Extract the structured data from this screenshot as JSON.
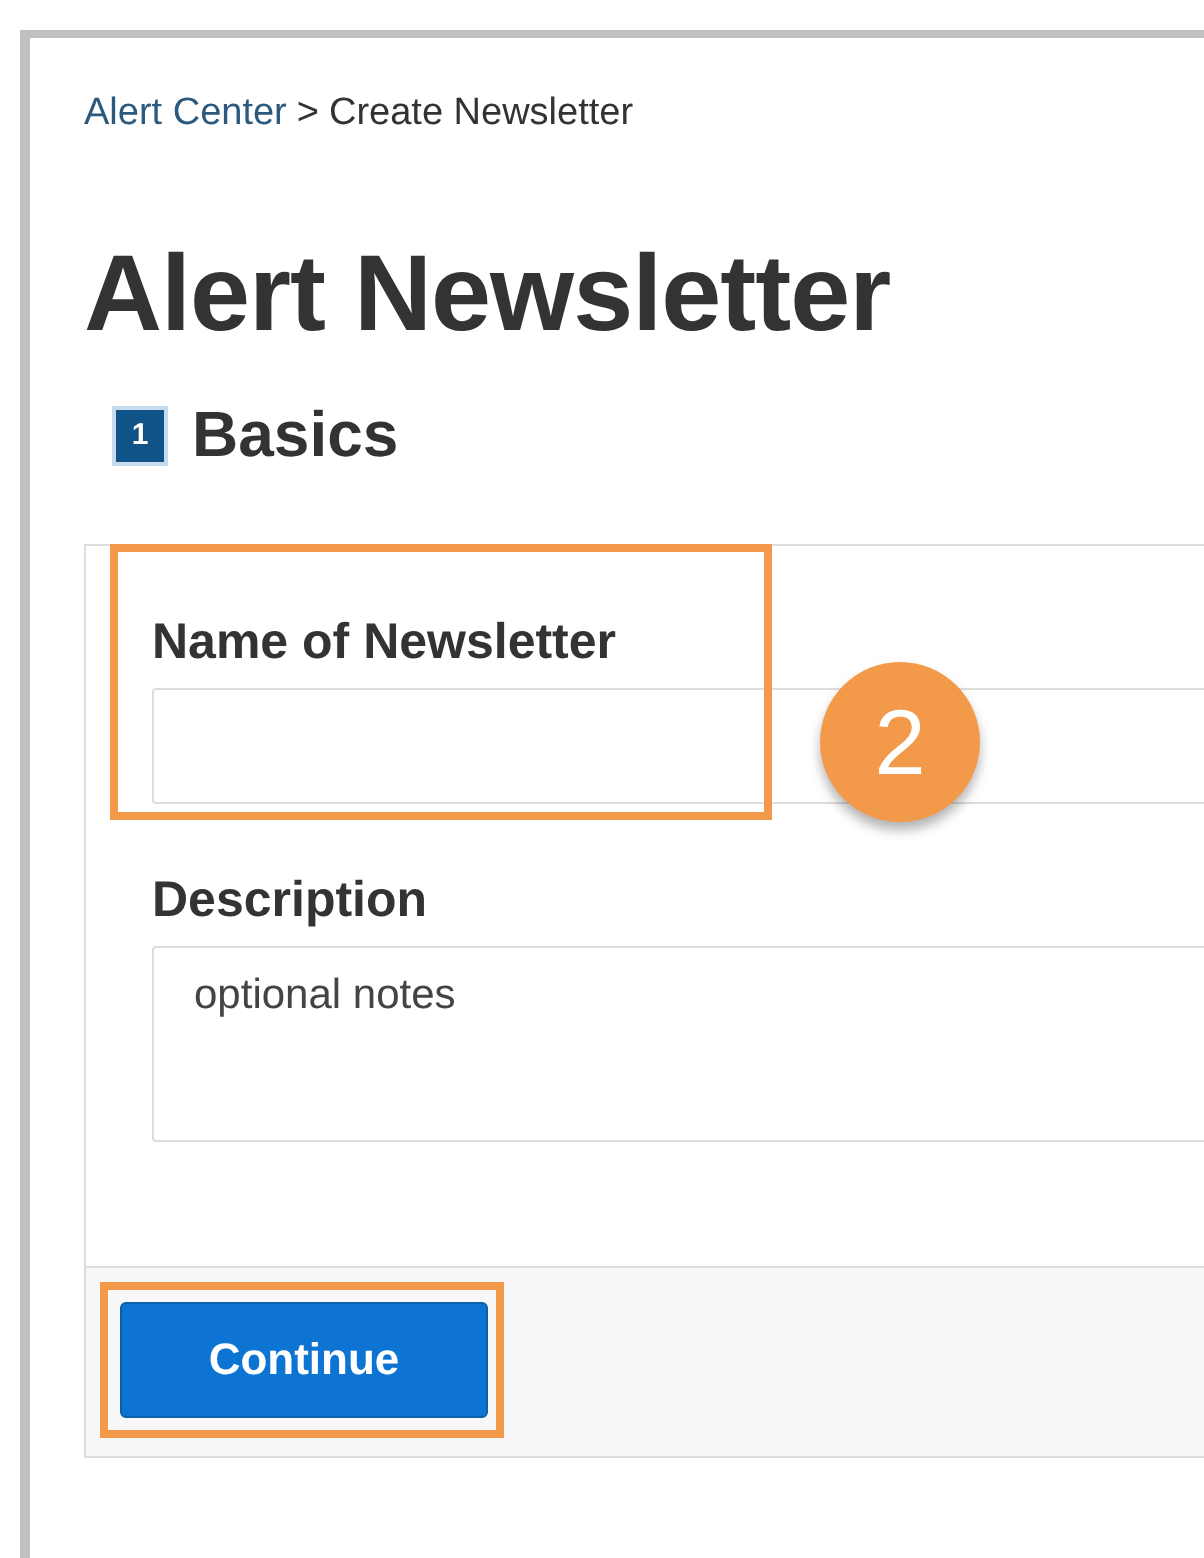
{
  "breadcrumb": [
    {
      "label": "Alert Center",
      "kind": "link"
    },
    {
      "label": ">",
      "kind": "separator"
    },
    {
      "label": "Create Newsletter",
      "kind": "current"
    }
  ],
  "title": "Alert Newsletter",
  "step": {
    "number": "1",
    "label": "Basics"
  },
  "fields": [
    {
      "label": "Name of Newsletter",
      "kind": "input",
      "highlighted": true
    },
    {
      "label": "Description",
      "kind": "textarea",
      "placeholder": "optional notes",
      "highlighted": false
    }
  ],
  "callout": "2",
  "button": {
    "label": "Continue",
    "highlighted": true
  }
}
